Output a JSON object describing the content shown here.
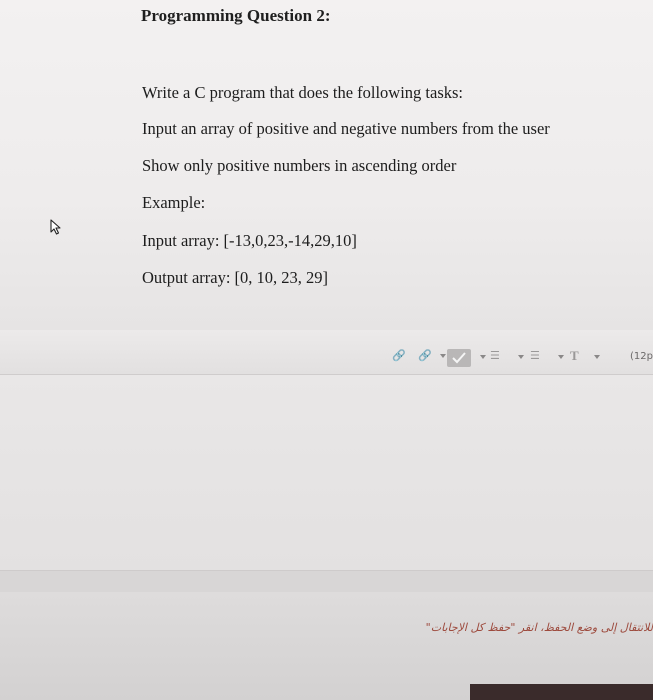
{
  "question": {
    "title": "Programming Question 2:",
    "lines": [
      "Write a C program that does the following tasks:",
      "Input an array of positive and negative numbers from the user",
      "Show only positive numbers in ascending order",
      "Example:",
      "Input array: [-13,0,23,-14,29,10]",
      "Output array: [0, 10, 23, 29]"
    ]
  },
  "toolbar": {
    "font_size": "(12p",
    "items": [
      "link-unlink",
      "link",
      "spellcheck",
      "ordered-list",
      "unordered-list",
      "text-format"
    ]
  },
  "footer": {
    "hint": "للانتقال إلى وضع الحفظ، انقر \"حفظ كل الإجابات\""
  }
}
